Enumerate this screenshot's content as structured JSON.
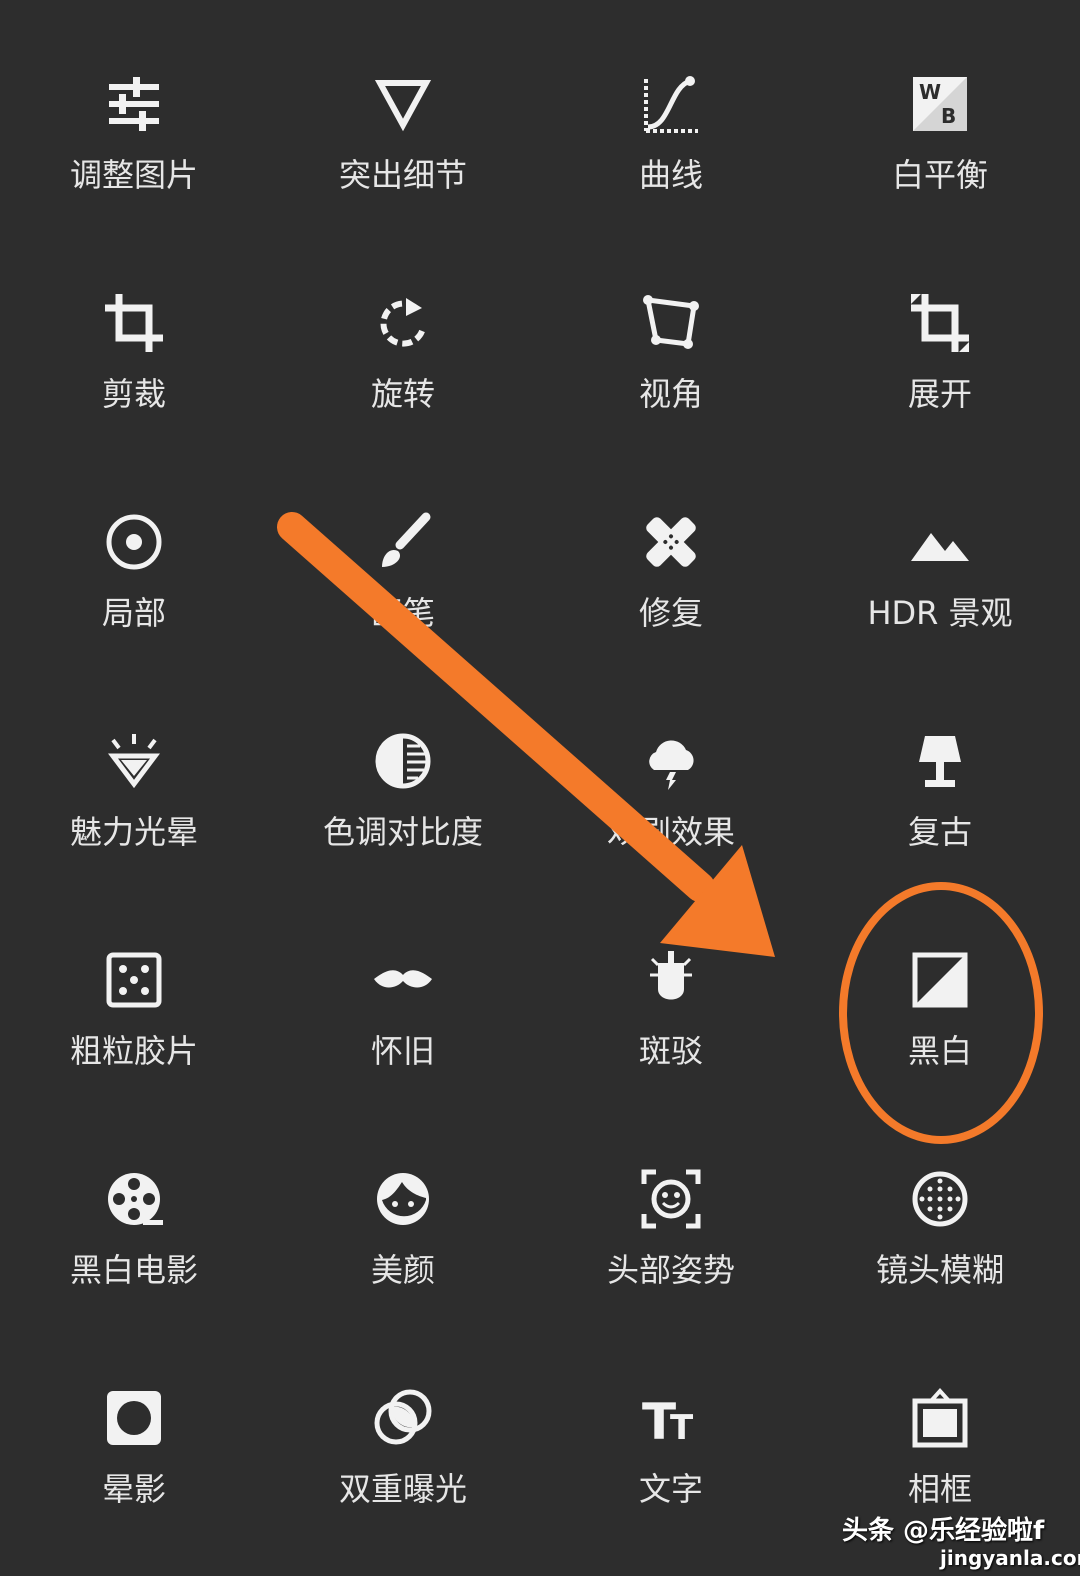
{
  "tools": [
    {
      "label": "调整图片",
      "icon": "sliders-icon"
    },
    {
      "label": "突出细节",
      "icon": "triangle-down-icon"
    },
    {
      "label": "曲线",
      "icon": "curve-icon"
    },
    {
      "label": "白平衡",
      "icon": "white-balance-icon"
    },
    {
      "label": "剪裁",
      "icon": "crop-icon"
    },
    {
      "label": "旋转",
      "icon": "rotate-icon"
    },
    {
      "label": "视角",
      "icon": "perspective-icon"
    },
    {
      "label": "展开",
      "icon": "expand-icon"
    },
    {
      "label": "局部",
      "icon": "target-icon"
    },
    {
      "label": "画笔",
      "icon": "brush-icon"
    },
    {
      "label": "修复",
      "icon": "bandage-icon"
    },
    {
      "label": "HDR 景观",
      "icon": "mountain-icon"
    },
    {
      "label": "魅力光晕",
      "icon": "diamond-icon"
    },
    {
      "label": "色调对比度",
      "icon": "tonal-contrast-icon"
    },
    {
      "label": "戏剧效果",
      "icon": "cloud-icon"
    },
    {
      "label": "复古",
      "icon": "lamp-icon"
    },
    {
      "label": "粗粒胶片",
      "icon": "grain-icon"
    },
    {
      "label": "怀旧",
      "icon": "mustache-icon"
    },
    {
      "label": "斑驳",
      "icon": "guitar-icon"
    },
    {
      "label": "黑白",
      "icon": "black-white-icon"
    },
    {
      "label": "黑白电影",
      "icon": "film-reel-icon"
    },
    {
      "label": "美颜",
      "icon": "face-icon"
    },
    {
      "label": "头部姿势",
      "icon": "face-frame-icon"
    },
    {
      "label": "镜头模糊",
      "icon": "lens-blur-icon"
    },
    {
      "label": "晕影",
      "icon": "vignette-icon"
    },
    {
      "label": "双重曝光",
      "icon": "double-exposure-icon"
    },
    {
      "label": "文字",
      "icon": "text-icon"
    },
    {
      "label": "相框",
      "icon": "frame-icon"
    }
  ],
  "annotation": {
    "color": "#f47a2a",
    "highlighted": "黑白"
  },
  "watermark": {
    "line1": "头条 @乐经验啦f",
    "line2": "jingyanla.com"
  }
}
